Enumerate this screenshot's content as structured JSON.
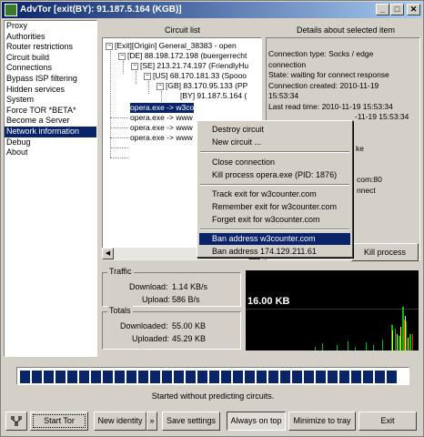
{
  "window": {
    "title": "AdvTor [exit(BY): 91.187.5.164 (KGB)]",
    "buttons": [
      "_",
      "□",
      "✕"
    ]
  },
  "nav": {
    "items": [
      {
        "label": "Proxy"
      },
      {
        "label": "Authorities"
      },
      {
        "label": "Router restrictions"
      },
      {
        "label": "Circuit build"
      },
      {
        "label": "Connections"
      },
      {
        "label": "Bypass ISP filtering"
      },
      {
        "label": "Hidden services"
      },
      {
        "label": "System"
      },
      {
        "label": "Force TOR *BETA*"
      },
      {
        "label": "Become a Server"
      },
      {
        "label": "Network information",
        "selected": true
      },
      {
        "label": "Debug"
      },
      {
        "label": "About"
      }
    ]
  },
  "circuit_list": {
    "header": "Circuit list",
    "nodes": [
      {
        "text": "[Exit][Origin] General_38383 - open",
        "box": "−"
      },
      {
        "text": "[DE] 88.198.172.198 (buergerrecht",
        "box": "−"
      },
      {
        "text": "[SE] 213.21.74.197 (FriendlyHu",
        "box": "−"
      },
      {
        "text": "[US] 68.170.181.33 (Spooo",
        "box": "−"
      },
      {
        "text": "[GB] 83.170.95.133 (PP",
        "box": "−"
      },
      {
        "text": "[BY] 91.187.5.164 (",
        "box": ""
      },
      {
        "text": "opera.exe -> w3co",
        "box": "",
        "selected": true
      },
      {
        "text": "opera.exe -> www",
        "box": ""
      },
      {
        "text": "opera.exe -> www",
        "box": ""
      },
      {
        "text": "opera.exe -> www",
        "box": ""
      }
    ]
  },
  "details": {
    "header": "Details about selected item",
    "lines": [
      "Connection type: Socks / edge",
      "connection",
      "State: waiting for connect response",
      "Connection created: 2010-11-19",
      "15:53:34",
      "Last read time: 2010-11-19 15:53:34",
      "-11-19 15:53:34",
      "",
      "",
      "ke",
      "",
      "",
      "com:80",
      "nnect"
    ],
    "kill_button": "Kill process"
  },
  "context_menu": {
    "items": [
      {
        "label": "Destroy circuit"
      },
      {
        "label": "New circuit ..."
      },
      {
        "label": "Close connection"
      },
      {
        "label": "Kill process opera.exe (PID: 1876)"
      },
      {
        "label": "Track exit for w3counter.com"
      },
      {
        "label": "Remember exit for w3counter.com"
      },
      {
        "label": "Forget exit for w3counter.com"
      },
      {
        "label": "Ban address w3counter.com",
        "selected": true
      },
      {
        "label": "Ban address 174.129.211.61"
      }
    ]
  },
  "traffic": {
    "title": "Traffic",
    "download_label": "Download:",
    "download_value": "1.14 KB/s",
    "upload_label": "Upload:",
    "upload_value": "586 B/s"
  },
  "totals": {
    "title": "Totals",
    "downloaded_label": "Downloaded:",
    "downloaded_value": "55.00 KB",
    "uploaded_label": "Uploaded:",
    "uploaded_value": "45.29 KB"
  },
  "graph": {
    "label": "16.00 KB"
  },
  "progress": {
    "fraction": 1.0,
    "color": "#0a246a"
  },
  "status_text": "Started without predicting circuits.",
  "bottom_buttons": {
    "start": "Start Tor",
    "new_identity": "New identity",
    "save": "Save settings",
    "always_on_top": "Always on top",
    "minimize": "Minimize to tray",
    "exit": "Exit"
  }
}
